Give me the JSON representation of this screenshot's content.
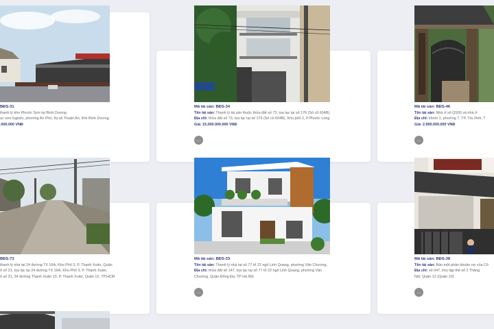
{
  "listings": [
    {
      "code": "BĐS-31",
      "name_text": "thanh lý kho Phước Sơn tại Bình Dương",
      "address_text": "ục sơn logistic, phường An Phú, thị xã Thuận An, tỉnh Bình Dương.",
      "price_text": ".000.000 VNĐ"
    },
    {
      "code_label": "Mã tài sản:",
      "code": "BĐS-34",
      "name_label": "Tên tài sản:",
      "name_text": "Thanh lý tài sản thuộc thửa đất số 73, tọa lạc tại số 176 (Số cũ 604B),",
      "address_label": "Địa chỉ:",
      "address_text": "thửa đất số 73, tọa lạc tại số 176 (Số cũ 604B), Khu phố 2, P.Phước Long",
      "price_text": "Giá: 15.000.000.000 VNĐ"
    },
    {
      "code_label": "Mã tài sản:",
      "code": "BĐS-46",
      "name_label": "Tên tài sản:",
      "name_text": "Nhà ở số QS00 và nhà ở",
      "address_label": "Địa chỉ:",
      "address_text": "khóm 1, phường 7, TP. Trà Vinh, T",
      "price_label": "Giá:",
      "price": "2.900.000.000 VNĐ"
    },
    {
      "code": "BĐS-73",
      "name_text": "thanh lý nhà tại 24 đường TX 16A, Khu Phố 3, P. Thạnh Xuân, Quận",
      "address_text": "ố số 31, tọa lạc tại 24 đường TX 16A, Khu Phố 3, P. Thạnh Xuân,",
      "address_text2": "ố số 31, 34 đường Thạnh Xuân 13, P. Thạnh Xuân, Quận 12, TP.HCM"
    },
    {
      "code_label": "Mã tài sản:",
      "code": "BĐS-33",
      "name_label": "Tên tài sản:",
      "name_text": "Thanh lý nhà tại số 77 tổ 22 ngõ Linh Quang, phường Văn Chương,",
      "address_label": "Địa chỉ:",
      "address_text": "thửa đất số 147, tọa lạc tại số 77 tổ 22 ngõ Linh Quang, phường Văn",
      "address_text2": "Chương, Quận Đống Đa, TP Hà Nội"
    },
    {
      "code_label": "Mã tài sản:",
      "code": "BĐS-38",
      "name_label": "Tên tài sản:",
      "name_text": "Bán một phần khoản nợ của Cô",
      "address_label": "Địa chỉ:",
      "address_text": "số 047, khu tập thể số 2 Thăng",
      "address_text2": "Nội, Quận 12 (Quận 10)"
    }
  ],
  "icons": {
    "more_icon": "ellipsis-circle-icon"
  },
  "colors": {
    "label_navy": "#2e3a78",
    "page_bg": "#eceef3",
    "card_bg": "#ffffff",
    "more_button": "#8d8d8d"
  }
}
